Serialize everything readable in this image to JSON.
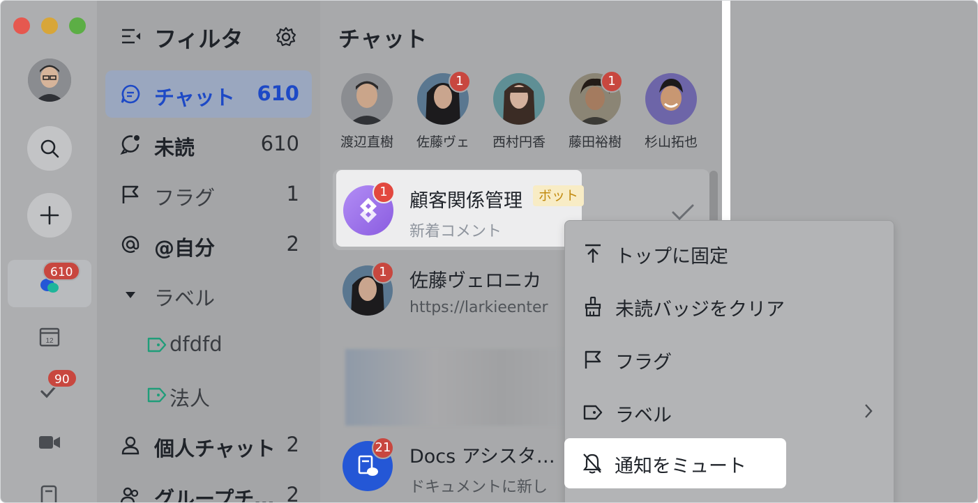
{
  "rail": {
    "chat_badge": "610",
    "todo_badge": "90",
    "calendar_day": "12"
  },
  "filter": {
    "title": "フィルタ",
    "items": [
      {
        "label": "チャット",
        "count": "610"
      },
      {
        "label": "未読",
        "count": "610"
      },
      {
        "label": "フラグ",
        "count": "1"
      },
      {
        "label": "@自分",
        "count": "2"
      },
      {
        "label": "ラベル",
        "count": ""
      },
      {
        "label": "dfdfd",
        "count": ""
      },
      {
        "label": "法人",
        "count": ""
      },
      {
        "label": "個人チャット",
        "count": "2"
      },
      {
        "label": "グループチ…",
        "count": "2"
      }
    ]
  },
  "chat": {
    "title": "チャット",
    "pinned": [
      {
        "name": "渡辺直樹",
        "badge": ""
      },
      {
        "name": "佐藤ヴェ",
        "badge": "1"
      },
      {
        "name": "西村円香",
        "badge": ""
      },
      {
        "name": "藤田裕樹",
        "badge": "1"
      },
      {
        "name": "杉山拓也",
        "badge": ""
      }
    ],
    "items": [
      {
        "title": "顧客関係管理",
        "tag": "ボット",
        "subtitle": "新着コメント",
        "badge": "1"
      },
      {
        "title": "佐藤ヴェロニカ",
        "subtitle": "https://larkieenter",
        "badge": "1"
      },
      {
        "title": "Docs アシスタ…",
        "subtitle": "ドキュメントに新し",
        "badge": "21"
      }
    ]
  },
  "menu": {
    "items": [
      {
        "label": "トップに固定",
        "icon": "pin-top-icon"
      },
      {
        "label": "未読バッジをクリア",
        "icon": "brush-icon"
      },
      {
        "label": "フラグ",
        "icon": "flag-icon"
      },
      {
        "label": "ラベル",
        "icon": "label-icon"
      },
      {
        "label": "通知をミュート",
        "icon": "bell-off-icon"
      }
    ]
  }
}
